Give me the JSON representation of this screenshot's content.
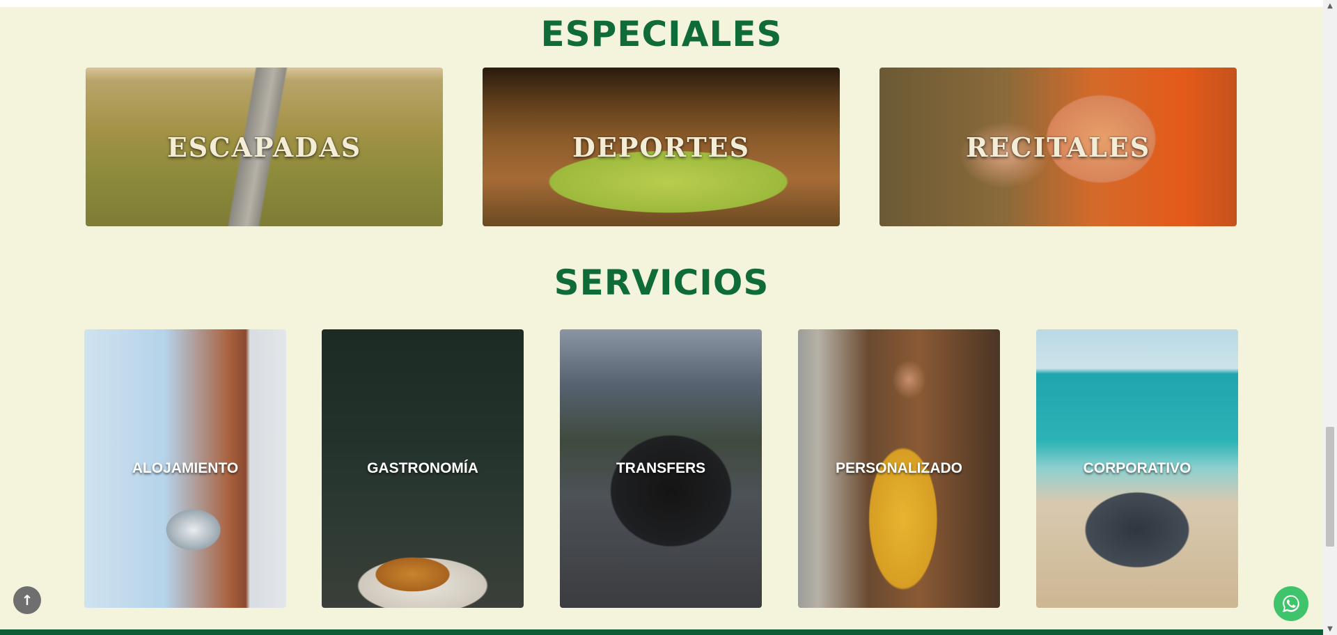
{
  "sections": {
    "especiales": {
      "title": "ESPECIALES",
      "cards": [
        {
          "label": "ESCAPADAS"
        },
        {
          "label": "DEPORTES"
        },
        {
          "label": "RECITALES"
        }
      ]
    },
    "servicios": {
      "title": "SERVICIOS",
      "cards": [
        {
          "label": "ALOJAMIENTO"
        },
        {
          "label": "GASTRONOMÍA"
        },
        {
          "label": "TRANSFERS"
        },
        {
          "label": "PERSONALIZADO"
        },
        {
          "label": "CORPORATIVO"
        }
      ]
    }
  },
  "floats": {
    "back_to_top_icon": "arrow-up-icon",
    "whatsapp_icon": "whatsapp-icon"
  },
  "colors": {
    "background": "#f4f3dc",
    "title_green": "#0f6b38",
    "footer_green": "#0c5f34",
    "whatsapp_green": "#3fc46b"
  },
  "scrollbar": {
    "up_arrow": "▲",
    "down_arrow": "▼"
  },
  "back_to_top_glyph": "↑"
}
